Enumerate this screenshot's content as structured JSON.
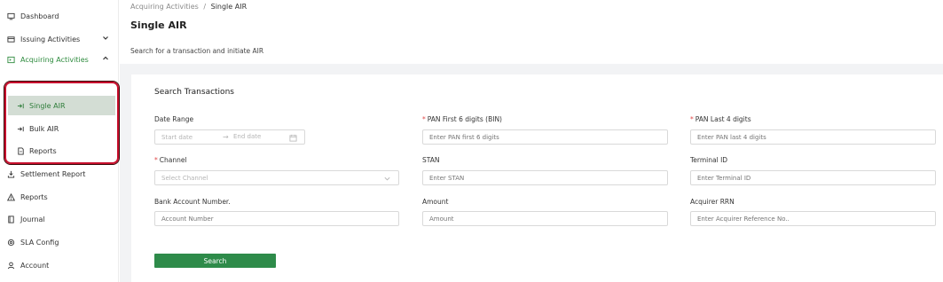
{
  "sidebar": {
    "items": [
      {
        "label": "Dashboard",
        "icon": "monitor-icon"
      },
      {
        "label": "Issuing Activities",
        "icon": "credit-card-icon"
      },
      {
        "label": "Acquiring Activities",
        "icon": "terminal-icon"
      },
      {
        "label": "Settlement Report",
        "icon": "download-icon"
      },
      {
        "label": "Reports",
        "icon": "warning-icon"
      },
      {
        "label": "Journal",
        "icon": "journal-icon"
      },
      {
        "label": "SLA Config",
        "icon": "gear-icon"
      },
      {
        "label": "Account",
        "icon": "user-icon"
      }
    ],
    "sub_items": [
      {
        "label": "Single AIR",
        "icon": "enter-icon"
      },
      {
        "label": "Bulk AIR",
        "icon": "enter-icon"
      },
      {
        "label": "Reports",
        "icon": "document-icon"
      }
    ]
  },
  "breadcrumb": {
    "parent": "Acquiring Activities",
    "separator": "/",
    "current": "Single AIR"
  },
  "page": {
    "title": "Single AIR",
    "subtitle": "Search for a transaction and initiate AIR"
  },
  "form": {
    "title": "Search Transactions",
    "date_range": {
      "label": "Date Range",
      "start_placeholder": "Start date",
      "arrow": "→",
      "end_placeholder": "End date"
    },
    "pan_first": {
      "label": "PAN First 6 digits (BIN)",
      "required_mark": "*",
      "placeholder": "Enter PAN first 6 digits"
    },
    "pan_last": {
      "label": "PAN Last 4 digits",
      "required_mark": "*",
      "placeholder": "Enter PAN last 4 digits"
    },
    "channel": {
      "label": "Channel",
      "required_mark": "*",
      "placeholder": "Select Channel"
    },
    "stan": {
      "label": "STAN",
      "placeholder": "Enter STAN"
    },
    "terminal_id": {
      "label": "Terminal ID",
      "placeholder": "Enter Terminal ID"
    },
    "bank_account": {
      "label": "Bank Account Number.",
      "placeholder": "Account Number"
    },
    "amount": {
      "label": "Amount",
      "placeholder": "Amount"
    },
    "acquirer_rrn": {
      "label": "Acquirer RRN",
      "placeholder": "Enter Acquirer Reference No.."
    },
    "search_label": "Search"
  },
  "colors": {
    "accent": "#2e8b4a",
    "required": "#e04848",
    "highlight": "#c8102e",
    "selected_bg": "#d3ddd4"
  }
}
